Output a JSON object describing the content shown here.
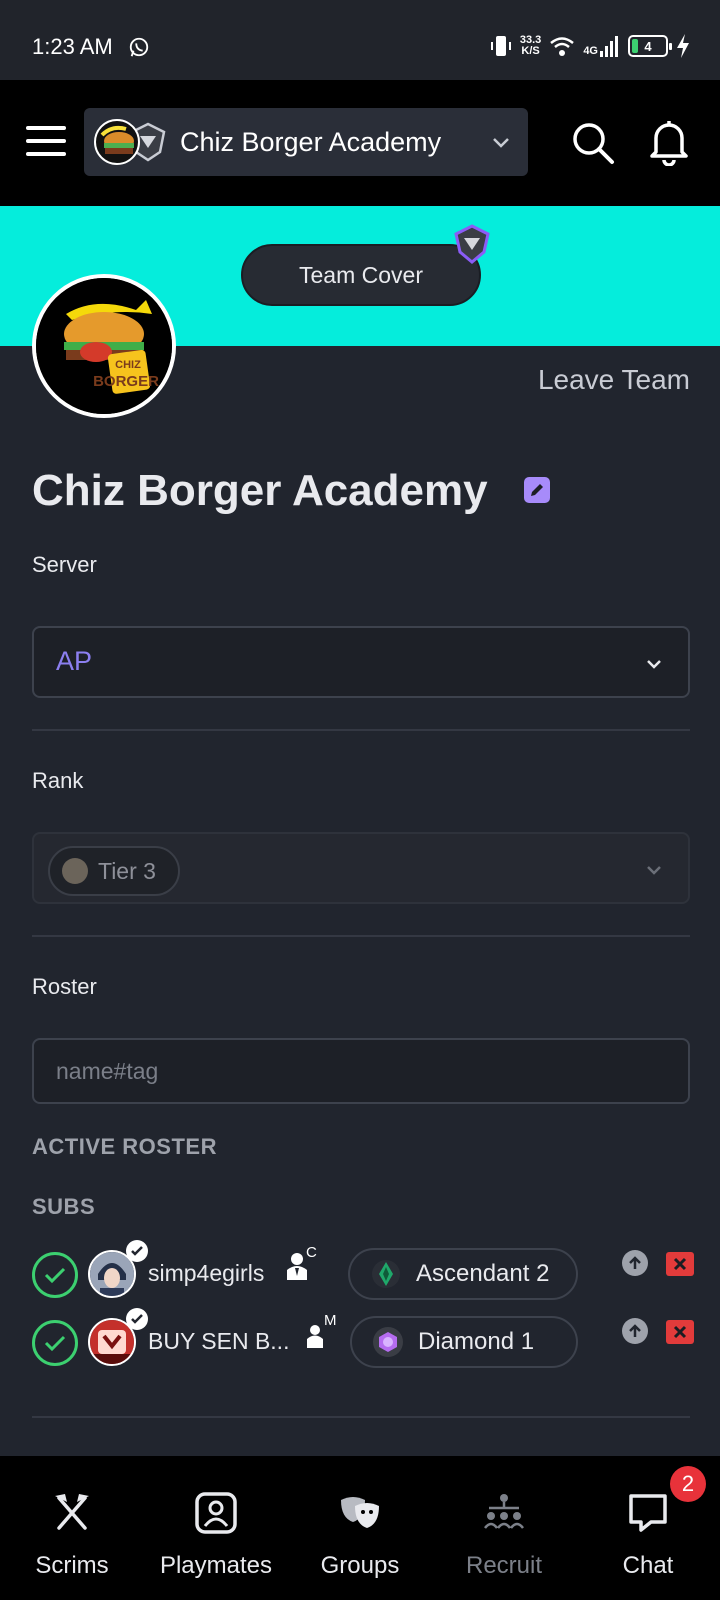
{
  "status_bar": {
    "time": "1:23 AM",
    "net_speed": "33.3",
    "net_unit": "K/S",
    "network": "4G",
    "battery": "4"
  },
  "header": {
    "team_name": "Chiz Borger Academy"
  },
  "cover": {
    "button_label": "Team Cover",
    "leave_label": "Leave Team"
  },
  "team": {
    "title": "Chiz Borger Academy",
    "logo_text_top": "CHIZ",
    "logo_text_bottom": "BORGER"
  },
  "server": {
    "label": "Server",
    "value": "AP"
  },
  "rank": {
    "label": "Rank",
    "value": "Tier 3"
  },
  "roster": {
    "label": "Roster",
    "placeholder": "name#tag",
    "active_heading": "ACTIVE ROSTER",
    "subs_heading": "SUBS",
    "subs": [
      {
        "name": "simp4egirls",
        "role_letter": "C",
        "rank": "Ascendant 2",
        "rank_color": "#1fa86a"
      },
      {
        "name": "BUY SEN B...",
        "role_letter": "M",
        "rank": "Diamond 1",
        "rank_color": "#b56cf0"
      }
    ]
  },
  "nav": {
    "items": [
      {
        "label": "Scrims",
        "icon": "crossed-axes-icon"
      },
      {
        "label": "Playmates",
        "icon": "profile-frame-icon"
      },
      {
        "label": "Groups",
        "icon": "masks-icon"
      },
      {
        "label": "Recruit",
        "icon": "recruit-icon"
      },
      {
        "label": "Chat",
        "icon": "chat-bubble-icon"
      }
    ],
    "chat_badge": "2"
  },
  "colors": {
    "cover": "#05eddc",
    "accent": "#8c7ff0",
    "ok": "#3cd070",
    "danger": "#e23b3b"
  }
}
